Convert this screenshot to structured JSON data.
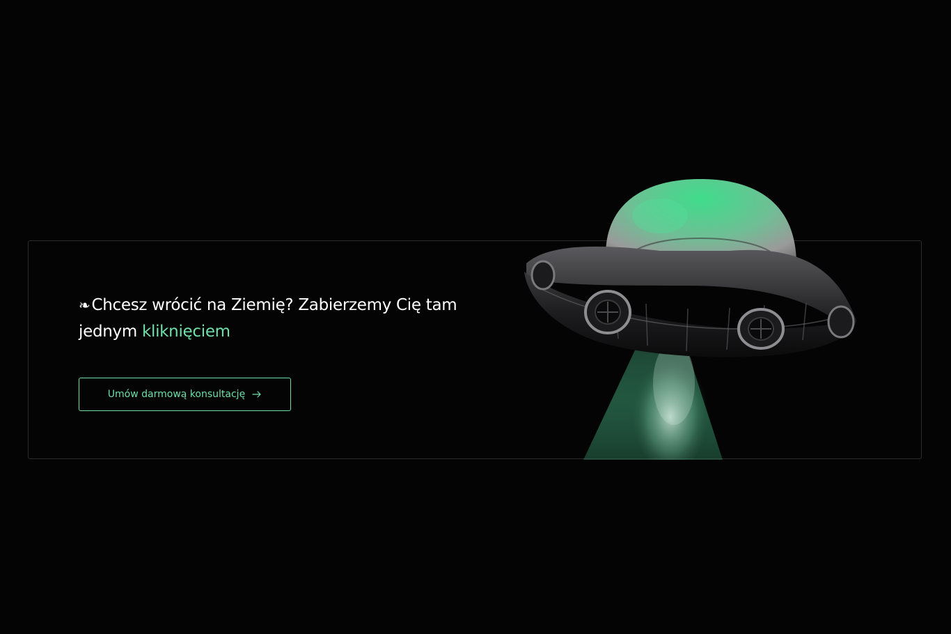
{
  "cta": {
    "headline_icon": "❧",
    "headline_text": "Chcesz wrócić na Ziemię? Zabierzemy Cię tam jednym ",
    "headline_accent": "kliknięciem",
    "button_label": "Umów darmową konsultację",
    "button_icon": "arrow-right-icon"
  },
  "image": {
    "name": "ufo-illustration"
  },
  "colors": {
    "background": "#040405",
    "accent": "#6ee0a8",
    "border": "#2c2c2f",
    "text": "#ffffff"
  }
}
